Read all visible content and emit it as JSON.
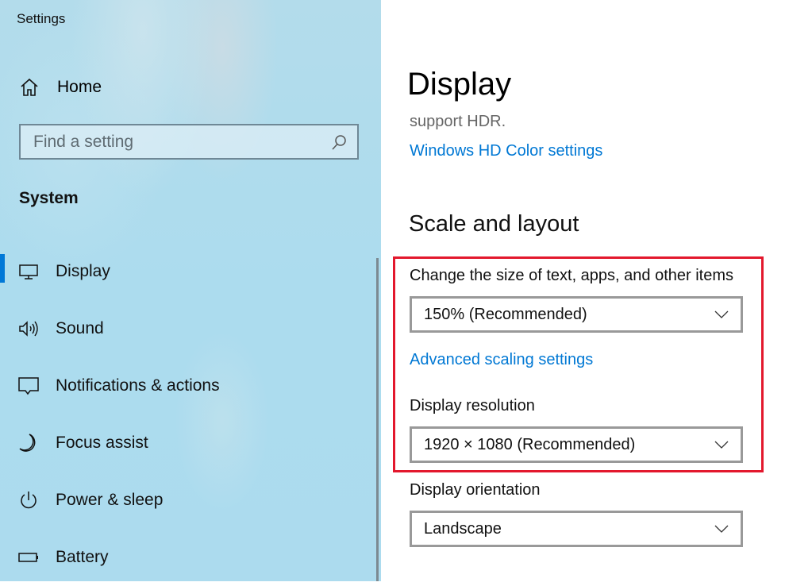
{
  "app": {
    "title": "Settings"
  },
  "sidebar": {
    "home_label": "Home",
    "search": {
      "placeholder": "Find a setting",
      "value": ""
    },
    "section_label": "System",
    "items": [
      {
        "label": "Display",
        "icon": "monitor-icon",
        "selected": true
      },
      {
        "label": "Sound",
        "icon": "speaker-icon",
        "selected": false
      },
      {
        "label": "Notifications & actions",
        "icon": "notification-icon",
        "selected": false
      },
      {
        "label": "Focus assist",
        "icon": "moon-icon",
        "selected": false
      },
      {
        "label": "Power & sleep",
        "icon": "power-icon",
        "selected": false
      },
      {
        "label": "Battery",
        "icon": "battery-icon",
        "selected": false
      }
    ],
    "accent_color": "#0078d7"
  },
  "main": {
    "page_title": "Display",
    "hdr_text": "support HDR.",
    "hdr_link": "Windows HD Color settings",
    "section_title": "Scale and layout",
    "scale": {
      "label": "Change the size of text, apps, and other items",
      "value": "150% (Recommended)"
    },
    "advanced_link": "Advanced scaling settings",
    "resolution": {
      "label": "Display resolution",
      "value": "1920 × 1080 (Recommended)"
    },
    "orientation": {
      "label": "Display orientation",
      "value": "Landscape"
    },
    "link_color": "#0078d4",
    "highlight_color": "#e3182d"
  }
}
